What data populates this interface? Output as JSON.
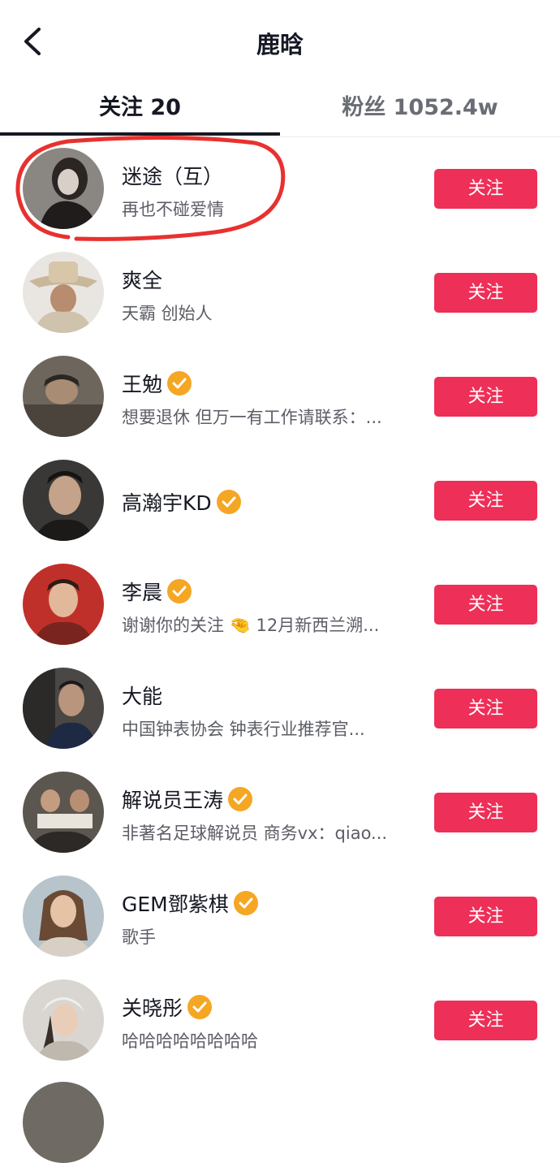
{
  "header": {
    "title": "鹿晗",
    "back_icon": "chevron-left-icon"
  },
  "tabs": [
    {
      "label": "关注 20",
      "active": true
    },
    {
      "label": "粉丝 1052.4w",
      "active": false
    }
  ],
  "users": [
    {
      "name": "迷途（互）",
      "bio": "再也不碰爱情",
      "verified": false,
      "button": "关注"
    },
    {
      "name": "爽全",
      "bio": "天霸 创始人",
      "verified": false,
      "button": "关注"
    },
    {
      "name": "王勉",
      "bio": "想要退休 但万一有工作请联系：...",
      "verified": true,
      "button": "关注"
    },
    {
      "name": "高瀚宇KD",
      "bio": "",
      "verified": true,
      "button": "关注"
    },
    {
      "name": "李晨",
      "bio": "谢谢你的关注 🤏 12月新西兰溯...",
      "verified": true,
      "button": "关注"
    },
    {
      "name": "大能",
      "bio": "中国钟表协会 钟表行业推荐官...",
      "verified": false,
      "button": "关注"
    },
    {
      "name": "解说员王涛",
      "bio": "非著名足球解说员 商务vx：qiao...",
      "verified": true,
      "button": "关注"
    },
    {
      "name": "GEM鄧紫棋",
      "bio": "歌手",
      "verified": true,
      "button": "关注"
    },
    {
      "name": "关晓彤",
      "bio": "哈哈哈哈哈哈哈哈",
      "verified": true,
      "button": "关注"
    }
  ],
  "colors": {
    "follow_button": "#ee2f57",
    "verified_badge": "#f5a623",
    "highlight_circle": "#e8312f",
    "text_primary": "#161823",
    "text_secondary": "#5c5e66"
  }
}
